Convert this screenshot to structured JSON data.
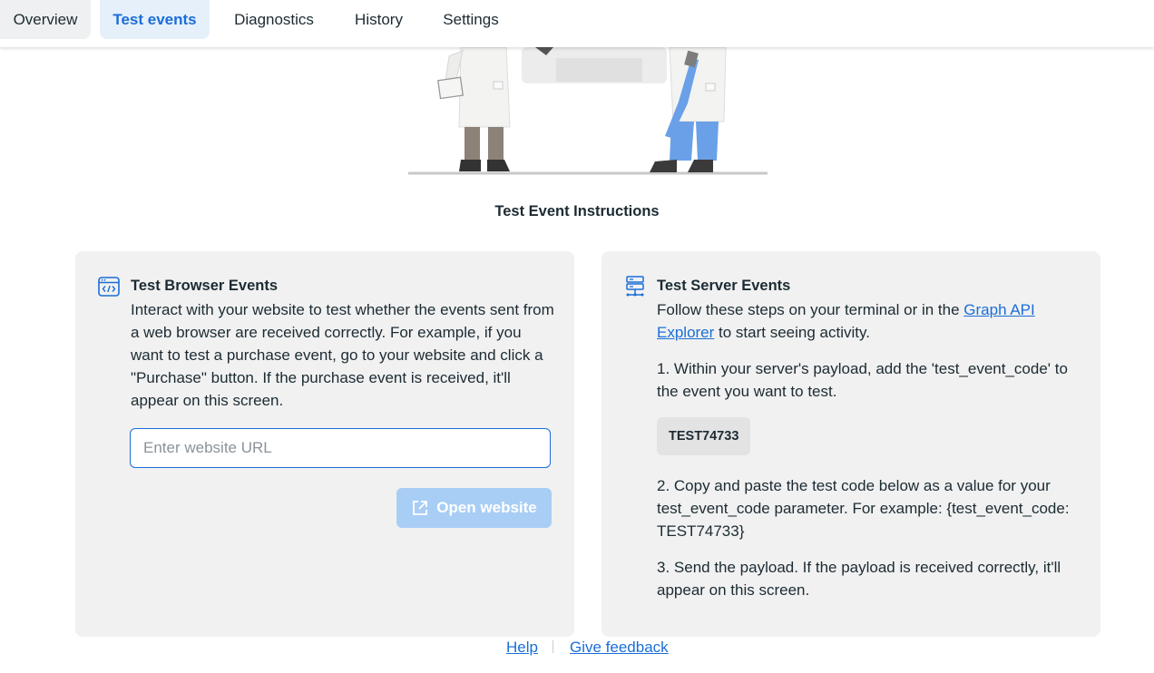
{
  "tabs": [
    {
      "label": "Overview"
    },
    {
      "label": "Test events"
    },
    {
      "label": "Diagnostics"
    },
    {
      "label": "History"
    },
    {
      "label": "Settings"
    }
  ],
  "active_tab": "Test events",
  "instructions_title": "Test Event Instructions",
  "browser_card": {
    "icon": "code-window-icon",
    "title": "Test Browser Events",
    "description": "Interact with your website to test whether the events sent from a web browser are received correctly. For example, if you want to test a purchase event, go to your website and click a \"Purchase\" button. If the purchase event is received, it'll appear on this screen.",
    "url_placeholder": "Enter website URL",
    "url_value": "",
    "open_button_label": "Open website"
  },
  "server_card": {
    "icon": "server-icon",
    "title": "Test Server Events",
    "intro_before_link": "Follow these steps on your terminal or in the ",
    "link_text": "Graph API Explorer",
    "intro_after_link": " to start seeing activity.",
    "step1": "1. Within your server's payload, add the 'test_event_code' to the event you want to test.",
    "test_code": "TEST74733",
    "step2": "2. Copy and paste the test code below as a value for your test_event_code parameter. For example: {test_event_code: TEST74733}",
    "step3": "3. Send the payload. If the payload is received correctly, it'll appear on this screen."
  },
  "footer": {
    "help_label": "Help",
    "feedback_label": "Give feedback"
  },
  "colors": {
    "accent": "#1a6ed8",
    "active_tab_bg": "#e6f0fb",
    "card_bg": "#f1f1f1",
    "disabled_button": "#a9cef5"
  }
}
